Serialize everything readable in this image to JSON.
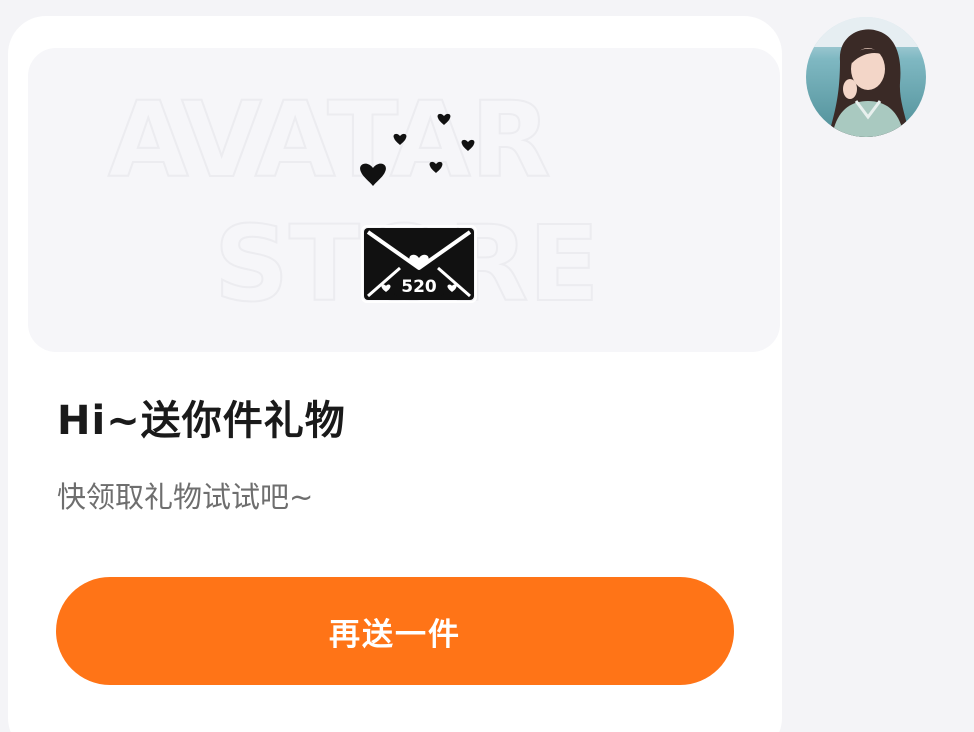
{
  "message": {
    "title": "Hi~送你件礼物",
    "subtitle": "快领取礼物试试吧~",
    "action_label": "再送一件"
  },
  "banner": {
    "watermark_line1": "AVATAR",
    "watermark_line2": "STORE",
    "envelope_badge": "520",
    "graphic": "love-letter-envelope-icon"
  },
  "avatar": {
    "icon": "user-avatar"
  },
  "colors": {
    "page_bg": "#f4f4f7",
    "card_bg": "#ffffff",
    "banner_bg": "#f6f6f9",
    "accent": "#ff7417",
    "title_text": "#1a1a1a",
    "subtitle_text": "#6e6e6e"
  }
}
